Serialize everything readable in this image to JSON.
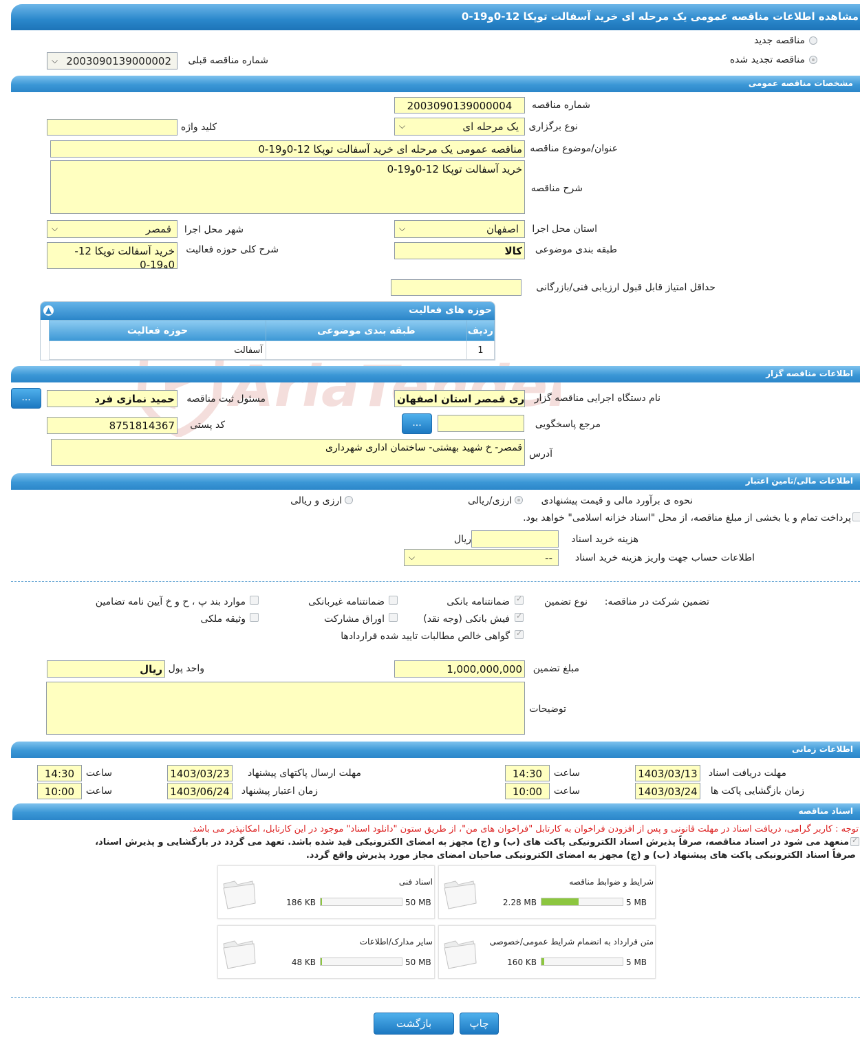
{
  "page_title": "مشاهده اطلاعات مناقصه عمومی یک مرحله ای خرید آسفالت توپکا 12-0و19-0",
  "tender_type": {
    "new_label": "مناقصه جدید",
    "renewed_label": "مناقصه تجدید شده",
    "renewed_selected": true,
    "prev_number_label": "شماره مناقصه قبلی",
    "prev_number_value": "2003090139000002"
  },
  "general": {
    "header": "مشخصات مناقصه عمومی",
    "number_label": "شماره مناقصه",
    "number_value": "2003090139000004",
    "method_label": "نوع برگزاری",
    "method_value": "یک مرحله ای",
    "keyword_label": "کلید واژه",
    "keyword_value": "",
    "subject_label": "عنوان/موضوع مناقصه",
    "subject_value": "مناقصه عمومی یک مرحله ای خرید آسفالت توپکا 12-0و19-0",
    "desc_label": "شرح مناقصه",
    "desc_value": "خرید آسفالت توپکا 12-0و19-0",
    "province_label": "استان محل اجرا",
    "province_value": "اصفهان",
    "city_label": "شهر محل اجرا",
    "city_value": "قمصر",
    "category_label": "طبقه بندی موضوعی",
    "category_value": "کالا",
    "activity_desc_label": "شرح کلی حوزه فعالیت",
    "activity_desc_value": "خرید آسفالت توپکا 12-0و19-0",
    "min_score_label": "حداقل امتیاز قابل قبول ارزیابی فنی/بازرگانی",
    "min_score_value": ""
  },
  "activities": {
    "title": "حوزه های فعالیت",
    "columns": [
      "ردیف",
      "طبقه بندی موضوعی",
      "حوزه فعالیت"
    ],
    "rows": [
      {
        "row": "1",
        "category": "",
        "area": "آسفالت"
      }
    ]
  },
  "organizer": {
    "header": "اطلاعات مناقصه گزار",
    "org_label": "نام دستگاه اجرایی مناقصه گزار",
    "org_value": "شهرداری قمصر استان اصفهان",
    "officer_label": "مسئول ثبت مناقصه",
    "officer_value": "حمید نمازی فرد",
    "more_btn": "...",
    "ref_label": "مرجع پاسخگویی",
    "ref_value": "",
    "postal_label": "کد پستی",
    "postal_value": "8751814367",
    "address_label": "آدرس",
    "address_value": "قمصر- خ شهید بهشتی- ساختمان اداری شهرداری"
  },
  "finance": {
    "header": "اطلاعات مالی/تامین اعتبار",
    "estimate_label": "نحوه ی برآورد مالی و قیمت پیشنهادی",
    "opt_rial": "ارزی/ریالی",
    "opt_fx": "ارزی و ریالی",
    "treasury_label": "پرداخت تمام و یا بخشی از مبلغ مناقصه، از محل \"اسناد خزانه اسلامی\" خواهد بود.",
    "doc_cost_label": "هزینه خرید اسناد",
    "doc_cost_value": "",
    "doc_cost_unit": "ریال",
    "account_label": "اطلاعات حساب جهت واریز هزینه خرید اسناد",
    "account_value": "--"
  },
  "guarantee": {
    "section_label": "تضمین شرکت در مناقصه:",
    "type_label": "نوع تضمین",
    "bank_guarantee": "ضمانتنامه بانکی",
    "nonbank_guarantee": "ضمانتنامه غیربانکی",
    "regulation_items": "موارد بند پ ، ح و خ آیین نامه تضامین",
    "bank_receipt": "فیش بانکی (وجه نقد)",
    "bonds": "اوراق مشارکت",
    "property": "وثیقه ملکی",
    "receivables": "گواهی خالص مطالبات تایید شده قراردادها",
    "amount_label": "مبلغ تضمین",
    "amount_value": "1,000,000,000",
    "currency_label": "واحد پول",
    "currency_value": "ریال",
    "notes_label": "توضیحات",
    "notes_value": ""
  },
  "timing": {
    "header": "اطلاعات زمانی",
    "doc_deadline_label": "مهلت دریافت اسناد",
    "doc_deadline_date": "1403/03/13",
    "doc_deadline_time": "14:30",
    "submit_deadline_label": "مهلت ارسال پاکتهای پیشنهاد",
    "submit_deadline_date": "1403/03/23",
    "submit_deadline_time": "14:30",
    "opening_label": "زمان بازگشایی پاکت ها",
    "opening_date": "1403/03/24",
    "opening_time": "10:00",
    "validity_label": "زمان اعتبار پیشنهاد",
    "validity_date": "1403/06/24",
    "validity_time": "10:00",
    "time_label": "ساعت"
  },
  "documents": {
    "header": "اسناد مناقصه",
    "notice": "توجه : کاربر گرامی، دریافت اسناد در مهلت قانونی و پس از افزودن فراخوان به کارتابل \"فراخوان های من\"، از طریق ستون \"دانلود اسناد\" موجود در این کارتابل، امکانپذیر می باشد.",
    "commitment_line1": "منعهد می شود در اسناد مناقصه، صرفاً پذیرش اسناد الکترونیکی پاکت های (ب) و (ج) مجهز به امضای الکترونیکی قید شده باشد. تعهد می گردد در بارگشایی و پذیرش اسناد،",
    "commitment_line2": "صرفاً اسناد الکترونیکی پاکت های پیشنهاد (ب) و (ج) مجهز به امضای الکترونیکی صاحبان امضای مجاز مورد پذیرش واقع گردد.",
    "files": [
      {
        "title": "شرایط و ضوابط مناقصه",
        "used": "2.28 MB",
        "max": "5 MB",
        "fraction": 0.456
      },
      {
        "title": "اسناد فنی",
        "used": "186 KB",
        "max": "50 MB",
        "fraction": 0.004
      },
      {
        "title": "متن قرارداد به انضمام شرایط عمومی/خصوصی",
        "used": "160 KB",
        "max": "5 MB",
        "fraction": 0.03
      },
      {
        "title": "سایر مدارک/اطلاعات",
        "used": "48 KB",
        "max": "50 MB",
        "fraction": 0.001
      }
    ]
  },
  "actions": {
    "print": "چاپ",
    "back": "بازگشت"
  },
  "watermark": {
    "text": "AriaTender.net"
  },
  "colors": {
    "header_blue": "#2b86c9",
    "field_yellow": "#ffffc0",
    "notice_red": "#d22",
    "progress_green": "#8cc63f"
  }
}
